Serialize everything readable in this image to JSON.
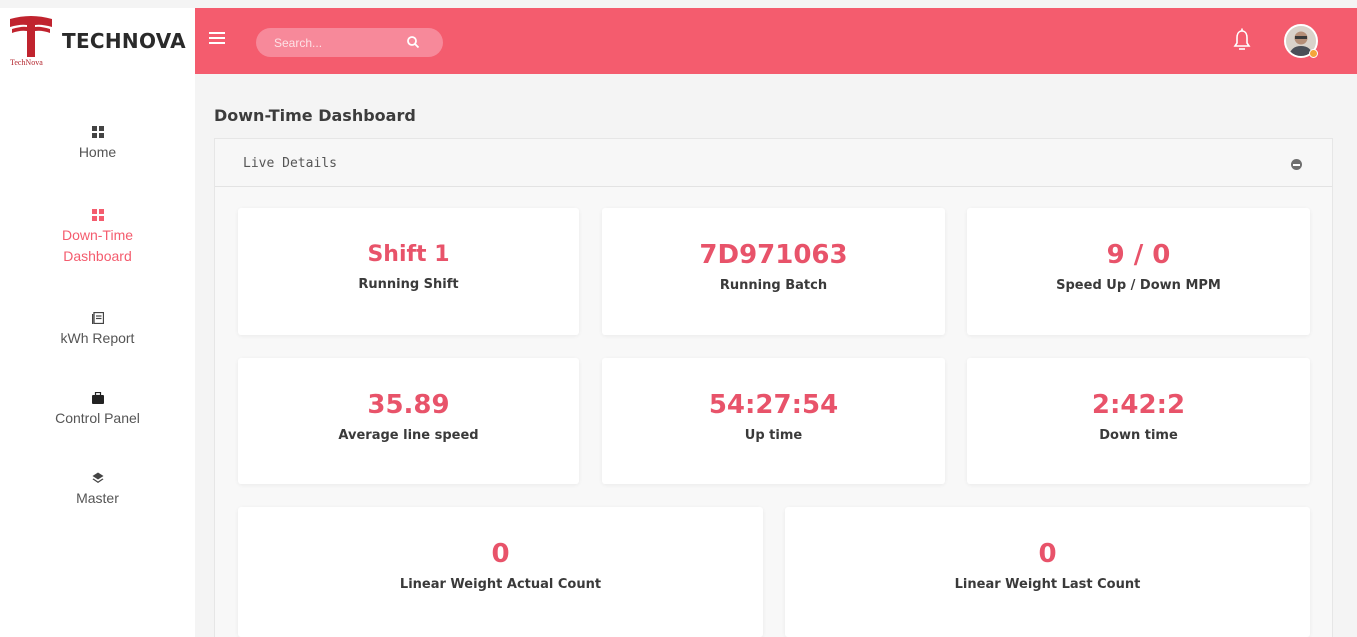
{
  "brand": {
    "name": "TECHNOVA",
    "subtext": "TechNova",
    "logo_color": "#c0232e"
  },
  "topbar": {
    "color": "#f45c6e",
    "search_placeholder": "Search...",
    "icons": [
      "hamburger-menu-icon",
      "search-icon",
      "bell-icon",
      "avatar"
    ]
  },
  "sidebar": {
    "items": [
      {
        "label": "Home",
        "icon": "grid-icon",
        "active": false
      },
      {
        "label": "Down-Time Dashboard",
        "line1": "Down-Time",
        "line2": "Dashboard",
        "icon": "grid-icon",
        "active": true
      },
      {
        "label": "kWh Report",
        "icon": "report-icon",
        "active": false
      },
      {
        "label": "Control Panel",
        "icon": "briefcase-icon",
        "active": false
      },
      {
        "label": "Master",
        "icon": "layers-icon",
        "active": false
      }
    ]
  },
  "page": {
    "title": "Down-Time Dashboard",
    "panel_title": "Live Details"
  },
  "cards": [
    {
      "value": "Shift 1",
      "label": "Running Shift"
    },
    {
      "value": "7D971063",
      "label": "Running Batch"
    },
    {
      "value": "9 / 0",
      "label": "Speed Up / Down MPM"
    },
    {
      "value": "35.89",
      "label": "Average line speed"
    },
    {
      "value": "54:27:54",
      "label": "Up time"
    },
    {
      "value": "2:42:2",
      "label": "Down time"
    },
    {
      "value": "0",
      "label": "Linear Weight Actual Count"
    },
    {
      "value": "0",
      "label": "Linear Weight Last Count"
    }
  ],
  "colors": {
    "accent": "#f45c6e",
    "value_text": "#e8536a"
  }
}
